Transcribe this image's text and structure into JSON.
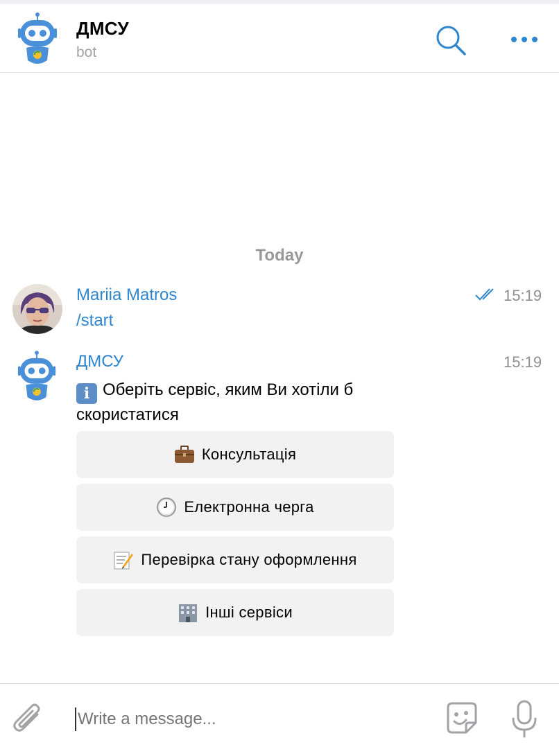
{
  "header": {
    "title": "ДМСУ",
    "subtitle": "bot",
    "icons": {
      "avatar": "robot-bot-avatar",
      "search": "search-icon",
      "more": "more-icon"
    }
  },
  "chat": {
    "date_separator": "Today",
    "messages": [
      {
        "sender": "Mariia Matros",
        "time": "15:19",
        "text": "/start",
        "status": "read"
      },
      {
        "sender": "ДМСУ",
        "time": "15:19",
        "text": "Оберіть сервіс, яким Ви хотіли б скористатися",
        "emoji": "ℹ️",
        "buttons": [
          {
            "label": "Консультація",
            "icon": "briefcase-icon"
          },
          {
            "label": "Електронна черга",
            "icon": "clock-icon"
          },
          {
            "label": "Перевірка стану оформлення",
            "icon": "memo-icon"
          },
          {
            "label": "Інші сервіси",
            "icon": "building-icon"
          }
        ]
      }
    ]
  },
  "composer": {
    "placeholder": "Write a message..."
  },
  "colors": {
    "accent": "#2e86cf",
    "muted": "#8e8e93",
    "button_bg": "#f2f2f3"
  }
}
